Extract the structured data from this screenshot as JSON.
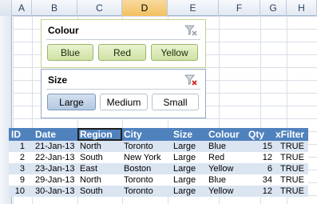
{
  "sheet": {
    "columns": [
      "A",
      "B",
      "C",
      "D",
      "E",
      "F",
      "G",
      "H",
      "I"
    ],
    "selected_column": "D"
  },
  "slicers": {
    "colour": {
      "title": "Colour",
      "items": [
        {
          "label": "Blue",
          "selected": true
        },
        {
          "label": "Red",
          "selected": true
        },
        {
          "label": "Yellow",
          "selected": true
        }
      ],
      "clear_icon": "clear-filter-icon"
    },
    "size": {
      "title": "Size",
      "items": [
        {
          "label": "Large",
          "selected": true
        },
        {
          "label": "Medium",
          "selected": false
        },
        {
          "label": "Small",
          "selected": false
        }
      ],
      "clear_icon": "clear-filter-active-icon"
    }
  },
  "table": {
    "headers": [
      "ID",
      "Date",
      "Region",
      "City",
      "Size",
      "Colour",
      "Qty",
      "xFilter"
    ],
    "active_header": "Region",
    "rows": [
      [
        "1",
        "21-Jan-13",
        "North",
        "Toronto",
        "Large",
        "Blue",
        "15",
        "TRUE"
      ],
      [
        "2",
        "22-Jan-13",
        "South",
        "New York",
        "Large",
        "Red",
        "12",
        "TRUE"
      ],
      [
        "3",
        "23-Jan-13",
        "East",
        "Boston",
        "Large",
        "Yellow",
        "6",
        "TRUE"
      ],
      [
        "9",
        "29-Jan-13",
        "North",
        "Toronto",
        "Large",
        "Blue",
        "34",
        "TRUE"
      ],
      [
        "10",
        "30-Jan-13",
        "South",
        "Toronto",
        "Large",
        "Yellow",
        "12",
        "TRUE"
      ]
    ]
  },
  "colors": {
    "table_header": "#4f81bd",
    "table_band": "#dbe5f1",
    "colour_slicer_item": "#d6e6b2",
    "size_slicer_selected": "#c2d4ea",
    "selected_column_header": "#f5cd7f"
  }
}
